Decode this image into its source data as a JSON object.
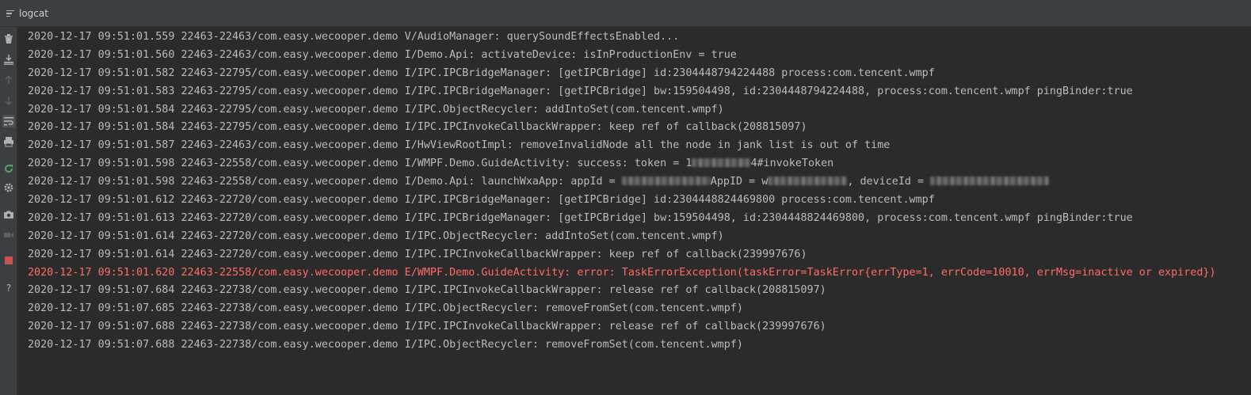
{
  "panel": {
    "title": "logcat"
  },
  "toolbar": {
    "icons": [
      "trash-icon",
      "scroll-to-end-icon",
      "up-arrow-icon",
      "down-arrow-icon",
      "soft-wrap-icon",
      "print-icon",
      "restart-icon",
      "settings-icon",
      "screenshot-icon",
      "screen-record-icon",
      "stop-icon",
      "help-icon"
    ]
  },
  "colors": {
    "error": "#ff6b68",
    "text": "#bbbbbb",
    "background": "#2b2b2b"
  },
  "log": [
    {
      "level": "V",
      "segments": [
        "2020-12-17 09:51:01.559 22463-22463/com.easy.wecooper.demo V/AudioManager: querySoundEffectsEnabled..."
      ]
    },
    {
      "level": "I",
      "segments": [
        "2020-12-17 09:51:01.560 22463-22463/com.easy.wecooper.demo I/Demo.Api: activateDevice: isInProductionEnv = true"
      ]
    },
    {
      "level": "I",
      "segments": [
        "2020-12-17 09:51:01.582 22463-22795/com.easy.wecooper.demo I/IPC.IPCBridgeManager: [getIPCBridge] id:2304448794224488 process:com.tencent.wmpf"
      ]
    },
    {
      "level": "I",
      "segments": [
        "2020-12-17 09:51:01.583 22463-22795/com.easy.wecooper.demo I/IPC.IPCBridgeManager: [getIPCBridge] bw:159504498, id:2304448794224488, process:com.tencent.wmpf pingBinder:true"
      ]
    },
    {
      "level": "I",
      "segments": [
        "2020-12-17 09:51:01.584 22463-22795/com.easy.wecooper.demo I/IPC.ObjectRecycler: addIntoSet(com.tencent.wmpf)"
      ]
    },
    {
      "level": "I",
      "segments": [
        "2020-12-17 09:51:01.584 22463-22795/com.easy.wecooper.demo I/IPC.IPCInvokeCallbackWrapper: keep ref of callback(208815097)"
      ]
    },
    {
      "level": "I",
      "segments": [
        "2020-12-17 09:51:01.587 22463-22463/com.easy.wecooper.demo I/HwViewRootImpl: removeInvalidNode all the node in jank list is out of time"
      ]
    },
    {
      "level": "I",
      "segments": [
        "2020-12-17 09:51:01.598 22463-22558/com.easy.wecooper.demo I/WMPF.Demo.GuideActivity: success: token = 1",
        "#redact",
        "4#invokeToken"
      ]
    },
    {
      "level": "I",
      "segments": [
        "2020-12-17 09:51:01.598 22463-22558/com.easy.wecooper.demo I/Demo.Api: launchWxaApp: appId = ",
        "#redact",
        "AppID = w",
        "#redact",
        ", deviceId = ",
        "#redact"
      ]
    },
    {
      "level": "I",
      "segments": [
        "2020-12-17 09:51:01.612 22463-22720/com.easy.wecooper.demo I/IPC.IPCBridgeManager: [getIPCBridge] id:2304448824469800 process:com.tencent.wmpf"
      ]
    },
    {
      "level": "I",
      "segments": [
        "2020-12-17 09:51:01.613 22463-22720/com.easy.wecooper.demo I/IPC.IPCBridgeManager: [getIPCBridge] bw:159504498, id:2304448824469800, process:com.tencent.wmpf pingBinder:true"
      ]
    },
    {
      "level": "I",
      "segments": [
        "2020-12-17 09:51:01.614 22463-22720/com.easy.wecooper.demo I/IPC.ObjectRecycler: addIntoSet(com.tencent.wmpf)"
      ]
    },
    {
      "level": "I",
      "segments": [
        "2020-12-17 09:51:01.614 22463-22720/com.easy.wecooper.demo I/IPC.IPCInvokeCallbackWrapper: keep ref of callback(239997676)"
      ]
    },
    {
      "level": "E",
      "segments": [
        "2020-12-17 09:51:01.620 22463-22558/com.easy.wecooper.demo E/WMPF.Demo.GuideActivity: error: TaskErrorException(taskError=TaskError{errType=1, errCode=10010, errMsg=inactive or expired})"
      ]
    },
    {
      "level": "I",
      "segments": [
        "2020-12-17 09:51:07.684 22463-22738/com.easy.wecooper.demo I/IPC.IPCInvokeCallbackWrapper: release ref of callback(208815097)"
      ]
    },
    {
      "level": "I",
      "segments": [
        "2020-12-17 09:51:07.685 22463-22738/com.easy.wecooper.demo I/IPC.ObjectRecycler: removeFromSet(com.tencent.wmpf)"
      ]
    },
    {
      "level": "I",
      "segments": [
        "2020-12-17 09:51:07.688 22463-22738/com.easy.wecooper.demo I/IPC.IPCInvokeCallbackWrapper: release ref of callback(239997676)"
      ]
    },
    {
      "level": "I",
      "segments": [
        "2020-12-17 09:51:07.688 22463-22738/com.easy.wecooper.demo I/IPC.ObjectRecycler: removeFromSet(com.tencent.wmpf)"
      ]
    }
  ]
}
